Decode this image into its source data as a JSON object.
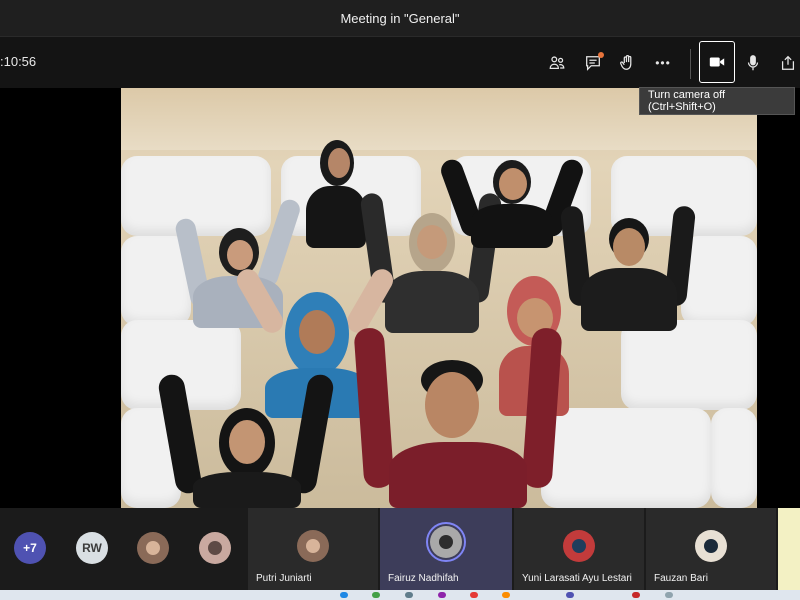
{
  "window": {
    "title": "Meeting in \"General\""
  },
  "toolbar": {
    "timer": ":10:56",
    "buttons": [
      {
        "name": "participants-button",
        "icon": "people-icon"
      },
      {
        "name": "chat-button",
        "icon": "chat-icon"
      },
      {
        "name": "raise-hand-button",
        "icon": "hand-icon"
      },
      {
        "name": "more-actions-button",
        "icon": "more-icon",
        "glyph": "•••"
      },
      {
        "name": "camera-button",
        "icon": "video-camera-icon",
        "active": true
      },
      {
        "name": "mic-button",
        "icon": "microphone-icon"
      },
      {
        "name": "share-button",
        "icon": "share-tray-icon"
      }
    ],
    "tooltip": "Turn camera off (Ctrl+Shift+O)",
    "notification_color": "#e8743b"
  },
  "participants": {
    "overflow": "+7",
    "overflow_color": "#4f52b2",
    "rw_initials": "RW",
    "tiles": [
      {
        "name": "Putri Juniarti"
      },
      {
        "name": "Fairuz Nadhifah",
        "speaking": true
      },
      {
        "name": "Yuni Larasati Ayu Lestari"
      },
      {
        "name": "Fauzan Bari"
      }
    ]
  },
  "colors": {
    "accent": "#7f85f5",
    "speaking_tile": "#3d3d5a"
  }
}
